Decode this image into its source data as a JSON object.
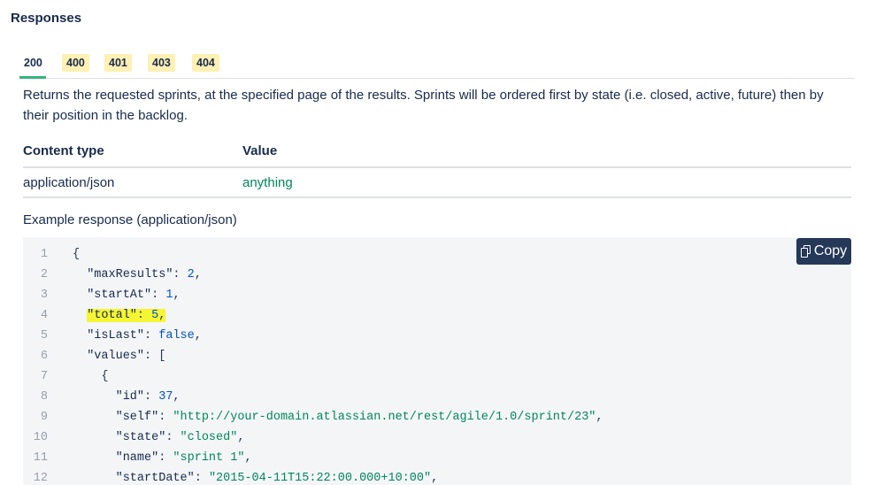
{
  "heading": "Responses",
  "tabs": [
    {
      "label": "200",
      "active": true
    },
    {
      "label": "400",
      "active": false
    },
    {
      "label": "401",
      "active": false
    },
    {
      "label": "403",
      "active": false
    },
    {
      "label": "404",
      "active": false
    }
  ],
  "description": "Returns the requested sprints, at the specified page of the results. Sprints will be ordered first by state (i.e. closed, active, future) then by their position in the backlog.",
  "table": {
    "headers": [
      "Content type",
      "Value"
    ],
    "rows": [
      [
        "application/json",
        "anything"
      ]
    ]
  },
  "example_label": "Example response (application/json)",
  "copy_label": "Copy",
  "code_lines": [
    {
      "n": "1",
      "text": "{"
    },
    {
      "n": "2",
      "text": "  \"maxResults\": 2,"
    },
    {
      "n": "3",
      "text": "  \"startAt\": 1,"
    },
    {
      "n": "4",
      "text": "  \"total\": 5,",
      "highlighted": true
    },
    {
      "n": "5",
      "text": "  \"isLast\": false,"
    },
    {
      "n": "6",
      "text": "  \"values\": ["
    },
    {
      "n": "7",
      "text": "    {"
    },
    {
      "n": "8",
      "text": "      \"id\": 37,"
    },
    {
      "n": "9",
      "text": "      \"self\": \"http://your-domain.atlassian.net/rest/agile/1.0/sprint/23\","
    },
    {
      "n": "10",
      "text": "      \"state\": \"closed\","
    },
    {
      "n": "11",
      "text": "      \"name\": \"sprint 1\","
    },
    {
      "n": "12",
      "text": "      \"startDate\": \"2015-04-11T15:22:00.000+10:00\","
    }
  ],
  "colors": {
    "accent_green": "#36b37e",
    "tab_bg": "#fff0b3",
    "highlight": "#f5f534",
    "copy_bg": "#253858"
  }
}
